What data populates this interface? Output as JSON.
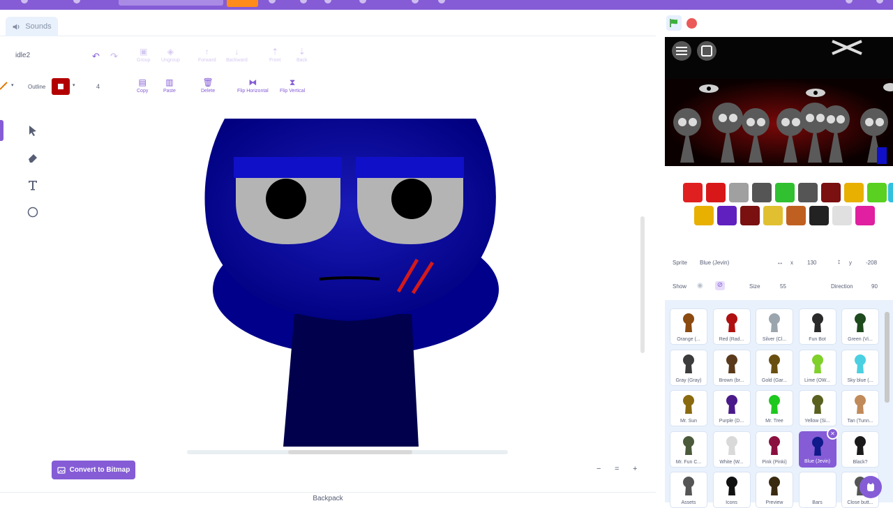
{
  "tabs": {
    "sounds_label": "Sounds"
  },
  "paint": {
    "costume_name": "idle2",
    "tools_row1": [
      {
        "label": "Group"
      },
      {
        "label": "Ungroup"
      },
      {
        "label": "Forward"
      },
      {
        "label": "Backward"
      },
      {
        "label": "Front"
      },
      {
        "label": "Back"
      }
    ],
    "tools_row2": [
      {
        "label": "Copy"
      },
      {
        "label": "Paste"
      },
      {
        "label": "Delete"
      },
      {
        "label": "Flip Horizontal"
      },
      {
        "label": "Flip Vertical"
      }
    ],
    "outline_label": "Outline",
    "outline_width": "4",
    "outline_color": "#b30000",
    "convert_label": "Convert to Bitmap",
    "backpack_label": "Backpack",
    "zoom_out_glyph": "−",
    "zoom_reset_glyph": "=",
    "zoom_in_glyph": "+"
  },
  "sprite_info": {
    "sprite_label": "Sprite",
    "sprite_name": "Blue (Jevin)",
    "x_label": "x",
    "x_value": "130",
    "y_label": "y",
    "y_value": "-208",
    "show_label": "Show",
    "size_label": "Size",
    "size_value": "55",
    "direction_label": "Direction",
    "direction_value": "90"
  },
  "sprites": [
    {
      "name": "Orange (...",
      "color": "#8a4a10"
    },
    {
      "name": "Red (Rad...",
      "color": "#b01010"
    },
    {
      "name": "Silver (Cl...",
      "color": "#9aa5ad"
    },
    {
      "name": "Fun Bot",
      "color": "#2a2a2a"
    },
    {
      "name": "Green (Vi...",
      "color": "#1e4a1e"
    },
    {
      "name": "Gray (Gray)",
      "color": "#3c3c3c"
    },
    {
      "name": "Brown (br...",
      "color": "#5a3a1a"
    },
    {
      "name": "Gold (Gar...",
      "color": "#6a5010"
    },
    {
      "name": "Lime (OW...",
      "color": "#7fd02a"
    },
    {
      "name": "Sky blue (...",
      "color": "#4ad0e0"
    },
    {
      "name": "Mr. Sun",
      "color": "#8a6a10"
    },
    {
      "name": "Purple (D...",
      "color": "#4a1a8a"
    },
    {
      "name": "Mr. Tree",
      "color": "#1ec81e"
    },
    {
      "name": "Yellow (Si...",
      "color": "#5a6020"
    },
    {
      "name": "Tan (Tunn...",
      "color": "#c08a5a"
    },
    {
      "name": "Mr. Fun C...",
      "color": "#4a5a3a"
    },
    {
      "name": "White (W...",
      "color": "#d9d9d9"
    },
    {
      "name": "Pink (Pinki)",
      "color": "#8a1040"
    },
    {
      "name": "Blue (Jevin)",
      "color": "#101a8a"
    },
    {
      "name": "Black?",
      "color": "#1a1a1a"
    },
    {
      "name": "Assets",
      "color": "#555555"
    },
    {
      "name": "Icons",
      "color": "#111111"
    },
    {
      "name": "Preview",
      "color": "#3a2a10"
    },
    {
      "name": "Bars",
      "color": "#ffffff"
    },
    {
      "name": "Close butt...",
      "color": "#555555"
    }
  ],
  "colors": {
    "accent": "#855cd6",
    "character_head": "#0a0aa0",
    "character_body": "#00004d",
    "stop": "#ec5959",
    "flag": "#3ab13a"
  }
}
